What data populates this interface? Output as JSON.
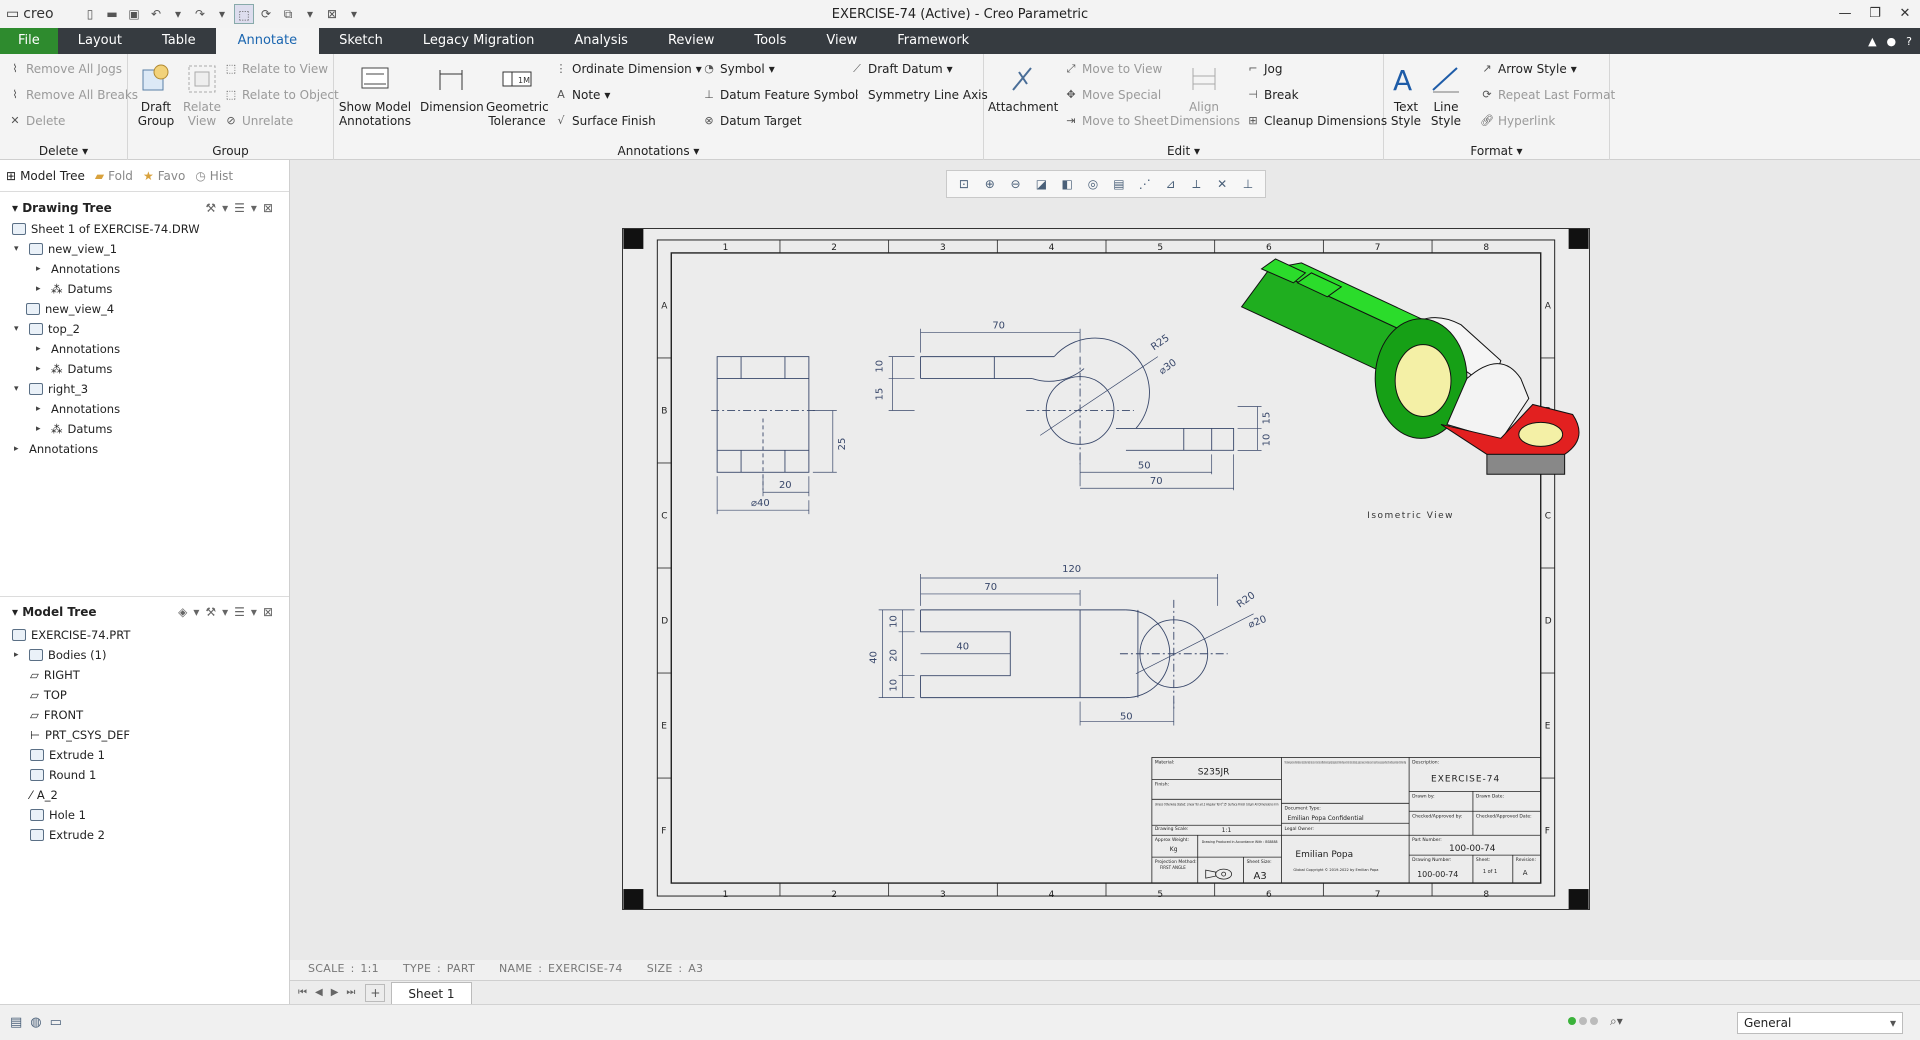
{
  "app": {
    "logo": "creo",
    "title": "EXERCISE-74 (Active) - Creo Parametric"
  },
  "tabs": [
    "File",
    "Layout",
    "Table",
    "Annotate",
    "Sketch",
    "Legacy Migration",
    "Analysis",
    "Review",
    "Tools",
    "View",
    "Framework"
  ],
  "active_tab": "Annotate",
  "ribbon": {
    "delete_group": {
      "label": "Delete",
      "items": [
        "Remove All Jogs",
        "Remove All Breaks",
        "Delete"
      ]
    },
    "group_group": {
      "label": "Group",
      "draft_group": "Draft\nGroup",
      "relate_view": "Relate\nView",
      "items": [
        "Relate to View",
        "Relate to Object",
        "Unrelate"
      ]
    },
    "annotations_group": {
      "label": "Annotations",
      "show_model": "Show Model\nAnnotations",
      "dimension": "Dimension",
      "geometric_tolerance": "Geometric\nTolerance",
      "ordinate_dimension": "Ordinate Dimension",
      "note": "Note",
      "surface_finish": "Surface Finish",
      "symbol": "Symbol",
      "datum_feature_symbol": "Datum Feature Symbol",
      "datum_target": "Datum Target",
      "draft_datum": "Draft Datum",
      "symmetry_line_axis": "Symmetry Line Axis"
    },
    "edit_group": {
      "label": "Edit",
      "attachment": "Attachment",
      "move_to_view": "Move to View",
      "move_special": "Move Special",
      "move_to_sheet": "Move to Sheet",
      "align_dimensions": "Align\nDimensions",
      "jog": "Jog",
      "break": "Break",
      "cleanup_dimensions": "Cleanup Dimensions"
    },
    "format_group": {
      "label": "Format",
      "text_style": "Text\nStyle",
      "line_style": "Line\nStyle",
      "arrow_style": "Arrow Style",
      "repeat_last_format": "Repeat Last Format",
      "hyperlink": "Hyperlink"
    }
  },
  "panel_tabs": [
    "Model Tree",
    "Fold",
    "Favo",
    "Hist"
  ],
  "drawing_tree": {
    "header": "Drawing Tree",
    "nodes": [
      "Sheet 1 of EXERCISE-74.DRW",
      "new_view_1",
      "Annotations",
      "Datums",
      "new_view_4",
      "top_2",
      "Annotations",
      "Datums",
      "right_3",
      "Annotations",
      "Datums",
      "Annotations"
    ]
  },
  "model_tree": {
    "header": "Model Tree",
    "nodes": [
      "EXERCISE-74.PRT",
      "Bodies (1)",
      "RIGHT",
      "TOP",
      "FRONT",
      "PRT_CSYS_DEF",
      "Extrude 1",
      "Round 1",
      "A_2",
      "Hole 1",
      "Extrude 2"
    ]
  },
  "drawing": {
    "zone_cols": [
      "1",
      "2",
      "3",
      "4",
      "5",
      "6",
      "7",
      "8"
    ],
    "zone_rows": [
      "A",
      "B",
      "C",
      "D",
      "E",
      "F"
    ],
    "front_dims": {
      "d70": "70",
      "r25": "R25",
      "d30": "⌀30",
      "d10": "10",
      "d15": "15",
      "d15b": "15",
      "d10b": "10",
      "d50": "50",
      "d70b": "70"
    },
    "side_dims": {
      "d25": "25",
      "d20": "20",
      "d40": "⌀40"
    },
    "top_dims": {
      "d120": "120",
      "d70": "70",
      "r20": "R20",
      "d20": "⌀20",
      "d40": "40",
      "d10": "10",
      "d20b": "20",
      "d10b": "10",
      "d40b": "40",
      "d50": "50"
    },
    "iso_label": "Isometric View",
    "title_block": {
      "material_label": "Material:",
      "material": "S235JR",
      "finish_label": "Finish:",
      "tolerances": "Unless Otherwise Stated: Linear Tol ±0.2 Angular Tol 0°15' Surface Finish 0.8µm All Dimensions mm",
      "scale_label": "Drawing Scale:",
      "scale": "1:1",
      "weight_label": "Approx Weight:",
      "weight": "Kg",
      "standard": "Drawing Produced in Accordance With : BS8888",
      "projection_label": "Projection Method:",
      "projection": "FIRST ANGLE",
      "sheet_size_label": "Sheet Size:",
      "sheet_size": "A3",
      "confidential_text": "This drawing and any information or descriptive matter set out on it are the confidential and copyright property of Emilian Popa and must not be disclosed, copied, loaned, in whole or part or used for any purpose without the written permission of Emilian Popa",
      "doc_type_label": "Document Type:",
      "doc_type": "Emilian Popa Confidential",
      "legal_owner_label": "Legal Owner:",
      "legal_owner": "Emilian Popa",
      "legal_note": "Global Copyright © 2019-2022 by Emilian Popa",
      "description_label": "Description:",
      "description": "EXERCISE-74",
      "drawn_by_label": "Drawn by:",
      "drawn_date_label": "Drawn Date:",
      "checked_label": "Checked/Approved by:",
      "checked_date_label": "Checked/Approved Date:",
      "part_number_label": "Part Number:",
      "part_number": "100-00-74",
      "drawing_number_label": "Drawing Number:",
      "drawing_number": "100-00-74",
      "sheet_label": "Sheet:",
      "sheet": "1 of 1",
      "revision_label": "Revision:",
      "revision": "A"
    }
  },
  "status": {
    "scale": "SCALE : 1:1",
    "type": "TYPE : PART",
    "name": "NAME : EXERCISE-74",
    "size": "SIZE : A3"
  },
  "sheet_tab": "Sheet 1",
  "filter": "General",
  "colors": {
    "accent": "#1b66b0",
    "file_tab": "#2e8b2e",
    "tabbar": "#363b40",
    "iso_green": "#22dd22",
    "iso_red": "#e02020",
    "iso_yellow": "#f4f0a6",
    "view_lines": "#38476a"
  }
}
